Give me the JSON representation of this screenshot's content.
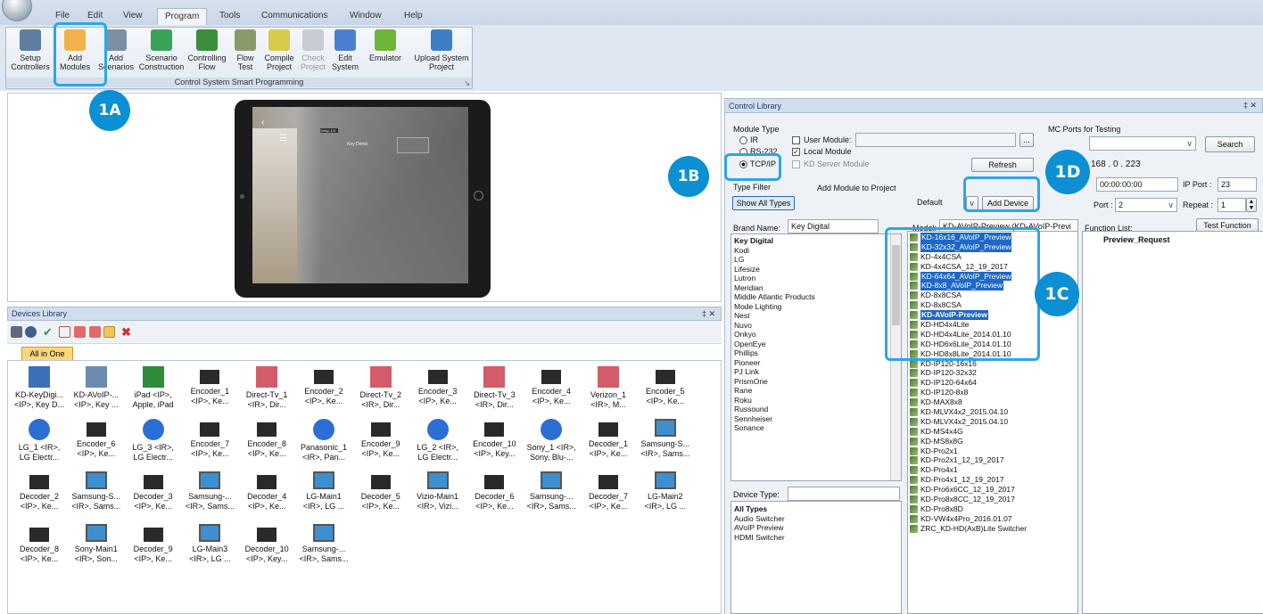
{
  "menu": [
    "File",
    "Edit",
    "View",
    "Program",
    "Tools",
    "Communications",
    "Window",
    "Help"
  ],
  "ribbon": {
    "buttons": [
      {
        "l1": "Setup",
        "l2": "Controllers",
        "icon": "setup-controllers-icon",
        "color": "#5f7da0",
        "dim": false
      },
      {
        "l1": "Add",
        "l2": "Modules",
        "icon": "add-modules-icon",
        "color": "#f2b24a",
        "dim": false
      },
      {
        "l1": "Add",
        "l2": "Scenarios",
        "icon": "add-scenarios-icon",
        "color": "#7f8fa3",
        "dim": false
      },
      {
        "l1": "Scenario",
        "l2": "Construction",
        "icon": "scenario-construction-icon",
        "color": "#3aa35a",
        "dim": false
      },
      {
        "l1": "Controlling",
        "l2": "Flow",
        "icon": "controlling-flow-icon",
        "color": "#3b8f3b",
        "dim": false
      },
      {
        "l1": "Flow",
        "l2": "Test",
        "icon": "flow-test-icon",
        "color": "#8a9a6a",
        "dim": false
      },
      {
        "l1": "Compile",
        "l2": "Project",
        "icon": "compile-project-icon",
        "color": "#d8c94a",
        "dim": false
      },
      {
        "l1": "Check",
        "l2": "Project",
        "icon": "check-project-icon",
        "color": "#c9ccd2",
        "dim": true
      },
      {
        "l1": "Edit",
        "l2": "System",
        "icon": "edit-system-icon",
        "color": "#4d7fd0",
        "dim": false
      },
      {
        "l1": "Emulator",
        "l2": "",
        "icon": "emulator-icon",
        "color": "#6fb53a",
        "dim": false
      },
      {
        "l1": "Upload System",
        "l2": "Project",
        "icon": "upload-system-project-icon",
        "color": "#3d7fc2",
        "dim": false
      }
    ],
    "group_label": "Control System Smart Programming"
  },
  "tablet": {
    "screen_title": "Key Demo",
    "screen_sub": "Setup 1/4"
  },
  "devices_library": {
    "title": "Devices Library",
    "pin": "‡ ✕",
    "tab": "All in One",
    "devices": [
      {
        "l1": "KD-KeyDigi...",
        "l2": "<IP>, Key D...",
        "icon": "network-device-icon",
        "color": "#3b6fb6"
      },
      {
        "l1": "KD-AVoIP-...",
        "l2": "<IP>, Key ...",
        "icon": "av-device-icon",
        "color": "#6a8ab0"
      },
      {
        "l1": "iPad <IP>,",
        "l2": "Apple, iPad",
        "icon": "ipad-icon",
        "color": "#2f8a3a"
      },
      {
        "l1": "Encoder_1",
        "l2": "<IP>, Ke...",
        "icon": "encoder-icon",
        "color": "#2a2a2a"
      },
      {
        "l1": "Direct-Tv_1",
        "l2": "<IR>, Dir...",
        "icon": "satellite-receiver-icon",
        "color": "#d45b6a"
      },
      {
        "l1": "Encoder_2",
        "l2": "<IP>, Ke...",
        "icon": "encoder-icon",
        "color": "#2a2a2a"
      },
      {
        "l1": "Direct-Tv_2",
        "l2": "<IR>, Dir...",
        "icon": "satellite-receiver-icon",
        "color": "#d45b6a"
      },
      {
        "l1": "Encoder_3",
        "l2": "<IP>, Ke...",
        "icon": "encoder-icon",
        "color": "#2a2a2a"
      },
      {
        "l1": "Direct-Tv_3",
        "l2": "<IR>, Dir...",
        "icon": "satellite-receiver-icon",
        "color": "#d45b6a"
      },
      {
        "l1": "Encoder_4",
        "l2": "<IP>, Ke...",
        "icon": "encoder-icon",
        "color": "#2a2a2a"
      },
      {
        "l1": "Verizon_1",
        "l2": "<IR>, M...",
        "icon": "satellite-receiver-icon",
        "color": "#d45b6a"
      },
      {
        "l1": "Encoder_5",
        "l2": "<IP>, Ke...",
        "icon": "encoder-icon",
        "color": "#2a2a2a"
      },
      {
        "l1": "LG_1 <IR>,",
        "l2": "LG Electr...",
        "icon": "disc-player-icon",
        "color": "#2b6fd6"
      },
      {
        "l1": "Encoder_6",
        "l2": "<IP>, Ke...",
        "icon": "encoder-icon",
        "color": "#2a2a2a"
      },
      {
        "l1": "LG_3 <IR>,",
        "l2": "LG Electr...",
        "icon": "disc-player-icon",
        "color": "#2b6fd6"
      },
      {
        "l1": "Encoder_7",
        "l2": "<IP>, Ke...",
        "icon": "encoder-icon",
        "color": "#2a2a2a"
      },
      {
        "l1": "Encoder_8",
        "l2": "<IP>, Ke...",
        "icon": "encoder-icon",
        "color": "#2a2a2a"
      },
      {
        "l1": "Panasonic_1",
        "l2": "<IR>, Pan...",
        "icon": "disc-player-icon",
        "color": "#2b6fd6"
      },
      {
        "l1": "Encoder_9",
        "l2": "<IP>, Ke...",
        "icon": "encoder-icon",
        "color": "#2a2a2a"
      },
      {
        "l1": "LG_2 <IR>,",
        "l2": "LG Electr...",
        "icon": "disc-player-icon",
        "color": "#2b6fd6"
      },
      {
        "l1": "Encoder_10",
        "l2": "<IP>, Key...",
        "icon": "encoder-icon",
        "color": "#2a2a2a"
      },
      {
        "l1": "Sony_1 <IR>,",
        "l2": "Sony, Blu-...",
        "icon": "disc-player-icon",
        "color": "#2b6fd6"
      },
      {
        "l1": "Decoder_1",
        "l2": "<IP>, Ke...",
        "icon": "decoder-icon",
        "color": "#2a2a2a"
      },
      {
        "l1": "Samsung-S...",
        "l2": "<IR>, Sams...",
        "icon": "tv-icon",
        "color": "#3d8fd0"
      },
      {
        "l1": "Decoder_2",
        "l2": "<IP>, Ke...",
        "icon": "decoder-icon",
        "color": "#2a2a2a"
      },
      {
        "l1": "Samsung-S...",
        "l2": "<IR>, Sams...",
        "icon": "tv-icon",
        "color": "#3d8fd0"
      },
      {
        "l1": "Decoder_3",
        "l2": "<IP>, Ke...",
        "icon": "decoder-icon",
        "color": "#2a2a2a"
      },
      {
        "l1": "Samsung-...",
        "l2": "<IR>, Sams...",
        "icon": "tv-icon",
        "color": "#3d8fd0"
      },
      {
        "l1": "Decoder_4",
        "l2": "<IP>, Ke...",
        "icon": "decoder-icon",
        "color": "#2a2a2a"
      },
      {
        "l1": "LG-Main1",
        "l2": "<IR>, LG ...",
        "icon": "tv-icon",
        "color": "#3d8fd0"
      },
      {
        "l1": "Decoder_5",
        "l2": "<IP>, Ke...",
        "icon": "decoder-icon",
        "color": "#2a2a2a"
      },
      {
        "l1": "Vizio-Main1",
        "l2": "<IR>, Vizi...",
        "icon": "tv-icon",
        "color": "#3d8fd0"
      },
      {
        "l1": "Decoder_6",
        "l2": "<IP>, Ke...",
        "icon": "decoder-icon",
        "color": "#2a2a2a"
      },
      {
        "l1": "Samsung-...",
        "l2": "<IR>, Sams...",
        "icon": "tv-icon",
        "color": "#3d8fd0"
      },
      {
        "l1": "Decoder_7",
        "l2": "<IP>, Ke...",
        "icon": "decoder-icon",
        "color": "#2a2a2a"
      },
      {
        "l1": "LG-Main2",
        "l2": "<IR>, LG ...",
        "icon": "tv-icon",
        "color": "#3d8fd0"
      },
      {
        "l1": "Decoder_8",
        "l2": "<IP>, Ke...",
        "icon": "decoder-icon",
        "color": "#2a2a2a"
      },
      {
        "l1": "Sony-Main1",
        "l2": "<IR>, Son...",
        "icon": "tv-icon",
        "color": "#3d8fd0"
      },
      {
        "l1": "Decoder_9",
        "l2": "<IP>, Ke...",
        "icon": "decoder-icon",
        "color": "#2a2a2a"
      },
      {
        "l1": "LG-Main3",
        "l2": "<IR>, LG ...",
        "icon": "tv-icon",
        "color": "#3d8fd0"
      },
      {
        "l1": "Decoder_10",
        "l2": "<IP>, Key...",
        "icon": "decoder-icon",
        "color": "#2a2a2a"
      },
      {
        "l1": "Samsung-...",
        "l2": "<IR>, Sams...",
        "icon": "tv-icon",
        "color": "#3d8fd0"
      }
    ]
  },
  "control_library": {
    "title": "Control Library",
    "pin": "‡ ✕",
    "module_type_label": "Module Type",
    "radio_ir": "IR",
    "radio_rs232": "RS-232",
    "radio_tcpip": "TCP/IP",
    "user_module": "User Module:",
    "local_module": "Local Module",
    "kd_server_module": "KD Server Module",
    "browse": "...",
    "refresh": "Refresh",
    "mc_ports": "MC Ports for Testing",
    "search": "Search",
    "ip_fragment": "168 . 0 . 223",
    "mac": "00:00:00:00",
    "ip_port_label": "IP Port :",
    "ip_port": "23",
    "port_label": "Port :",
    "port_value": "2",
    "repeat_label": "Repeat :",
    "repeat_value": "1",
    "type_filter": "Type Filter",
    "show_all_types": "Show All Types",
    "add_module_to_project": "Add Module to Project",
    "default": "Default",
    "add_device": "Add Device",
    "brand_name_label": "Brand Name:",
    "brand_name_value": "Key Digital",
    "model_label": "Model:",
    "model_value": "KD-AVoIP-Preview (KD-AVoIP-Previ",
    "function_list_label": "Function List:",
    "test_function": "Test Function",
    "function_item": "Preview_Request",
    "device_type_label": "Device Type:",
    "brands": [
      "Key Digital",
      "Kodi",
      "LG",
      "Lifesize",
      "Lutron",
      "Meridian",
      "Middle Atlantic Products",
      "Mode Lighting",
      "Nest",
      "Nuvo",
      "Onkyo",
      "OpenEye",
      "Phillips",
      "Pioneer",
      "PJ Link",
      "PrismOne",
      "Rane",
      "Roku",
      "Russound",
      "Sennheiser",
      "Sonance"
    ],
    "device_types": [
      "All Types",
      "Audio Switcher",
      "AVoIP Preview",
      "HDMI Switcher"
    ],
    "models": [
      {
        "t": "KD-16x16_AVoIP_Preview",
        "sel": true,
        "bold": false
      },
      {
        "t": "KD-32x32_AVoIP_Preview",
        "sel": true,
        "bold": false
      },
      {
        "t": "KD-4x4CSA",
        "sel": false,
        "bold": false
      },
      {
        "t": "KD-4x4CSA_12_19_2017",
        "sel": false,
        "bold": false
      },
      {
        "t": "KD-64x64_AVoIP_Preview",
        "sel": true,
        "bold": false
      },
      {
        "t": "KD-8x8_AVoIP_Preview",
        "sel": true,
        "bold": false
      },
      {
        "t": "KD-8x8CSA",
        "sel": false,
        "bold": false
      },
      {
        "t": "KD-8x8CSA",
        "sel": false,
        "bold": false
      },
      {
        "t": "KD-AVoIP-Preview",
        "sel": true,
        "bold": true
      },
      {
        "t": "KD-HD4x4Lite",
        "sel": false,
        "bold": false
      },
      {
        "t": "KD-HD4x4Lite_2014.01.10",
        "sel": false,
        "bold": false
      },
      {
        "t": "KD-HD6x6Lite_2014.01.10",
        "sel": false,
        "bold": false
      },
      {
        "t": "KD-HD8x8Lite_2014.01.10",
        "sel": false,
        "bold": false
      },
      {
        "t": "KD-IP120-16x16",
        "sel": false,
        "bold": false
      },
      {
        "t": "KD-IP120-32x32",
        "sel": false,
        "bold": false
      },
      {
        "t": "KD-IP120-64x64",
        "sel": false,
        "bold": false
      },
      {
        "t": "KD-IP120-8x8",
        "sel": false,
        "bold": false
      },
      {
        "t": "KD-MAX8x8",
        "sel": false,
        "bold": false
      },
      {
        "t": "KD-MLVX4x2_2015.04.10",
        "sel": false,
        "bold": false
      },
      {
        "t": "KD-MLVX4x2_2015.04.10",
        "sel": false,
        "bold": false
      },
      {
        "t": "KD-MS4x4G",
        "sel": false,
        "bold": false
      },
      {
        "t": "KD-MS8x8G",
        "sel": false,
        "bold": false
      },
      {
        "t": "KD-Pro2x1",
        "sel": false,
        "bold": false
      },
      {
        "t": "KD-Pro2x1_12_19_2017",
        "sel": false,
        "bold": false
      },
      {
        "t": "KD-Pro4x1",
        "sel": false,
        "bold": false
      },
      {
        "t": "KD-Pro4x1_12_19_2017",
        "sel": false,
        "bold": false
      },
      {
        "t": "KD-Pro6x6CC_12_19_2017",
        "sel": false,
        "bold": false
      },
      {
        "t": "KD-Pro8x8CC_12_19_2017",
        "sel": false,
        "bold": false
      },
      {
        "t": "KD-Pro8x8D",
        "sel": false,
        "bold": false
      },
      {
        "t": "KD-VW4x4Pro_2016.01.07",
        "sel": false,
        "bold": false
      },
      {
        "t": "ZRC_KD-HD(AxB)Lite Switcher",
        "sel": false,
        "bold": false
      }
    ]
  },
  "callouts": {
    "c1a": "1A",
    "c1b": "1B",
    "c1c": "1C",
    "c1d": "1D"
  },
  "colors": {
    "callout": "#0d8fd4",
    "highlight": "#2aa7e8",
    "selection": "#1e68c8"
  }
}
